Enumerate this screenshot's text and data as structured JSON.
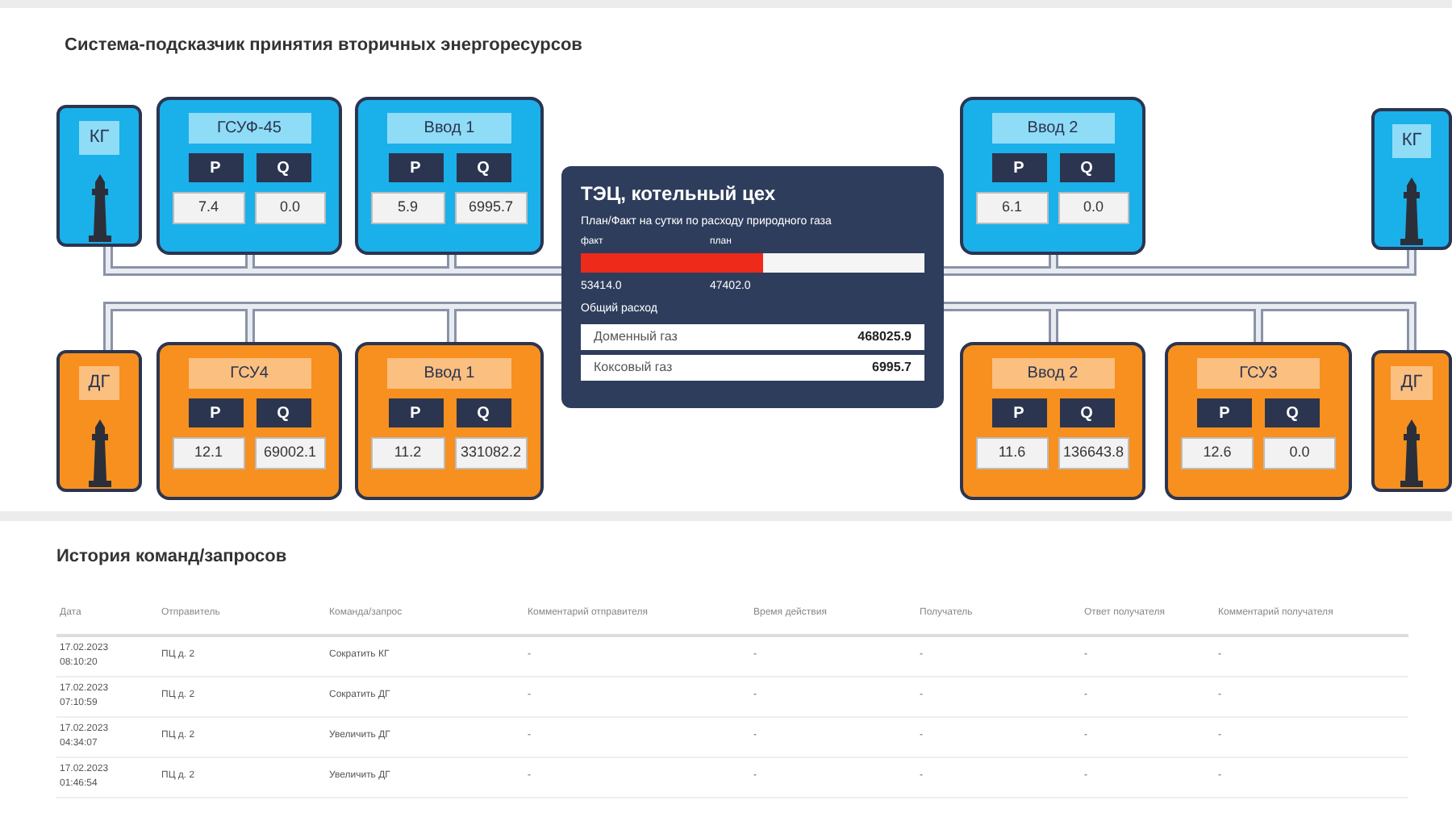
{
  "diagram": {
    "title": "Система-подсказчик принятия вторичных энергоресурсов",
    "nodes": [
      {
        "kind": "tower",
        "label": "КГ",
        "color": "#1ab0ea"
      },
      {
        "kind": "unit",
        "label": "ГСУФ-45",
        "color": "#1ab0ea",
        "p_label": "P",
        "q_label": "Q",
        "p_value": "7.4",
        "q_value": "0.0"
      },
      {
        "kind": "unit",
        "label": "Ввод 1",
        "color": "#1ab0ea",
        "p_label": "P",
        "q_label": "Q",
        "p_value": "5.9",
        "q_value": "6995.7"
      },
      {
        "kind": "unit",
        "label": "Ввод 2",
        "color": "#1ab0ea",
        "p_label": "P",
        "q_label": "Q",
        "p_value": "6.1",
        "q_value": "0.0"
      },
      {
        "kind": "tower",
        "label": "КГ",
        "color": "#1ab0ea"
      },
      {
        "kind": "tower",
        "label": "ДГ",
        "color": "#f7901e"
      },
      {
        "kind": "unit",
        "label": "ГСУ4",
        "color": "#f7901e",
        "p_label": "P",
        "q_label": "Q",
        "p_value": "12.1",
        "q_value": "69002.1"
      },
      {
        "kind": "unit",
        "label": "Ввод 1",
        "color": "#f7901e",
        "p_label": "P",
        "q_label": "Q",
        "p_value": "11.2",
        "q_value": "331082.2"
      },
      {
        "kind": "unit",
        "label": "Ввод 2",
        "color": "#f7901e",
        "p_label": "P",
        "q_label": "Q",
        "p_value": "11.6",
        "q_value": "136643.8"
      },
      {
        "kind": "unit",
        "label": "ГСУ3",
        "color": "#f7901e",
        "p_label": "P",
        "q_label": "Q",
        "p_value": "12.6",
        "q_value": "0.0"
      },
      {
        "kind": "tower",
        "label": "ДГ",
        "color": "#f7901e"
      }
    ],
    "plant": {
      "title": "ТЭЦ, котельный цех",
      "subtitle": "План/Факт на сутки по расходу природного газа",
      "fact_label": "факт",
      "plan_label": "план",
      "level": 0.53,
      "fact_value": "53414.0",
      "plan_value": "47402.0",
      "total_label": "Общий расход",
      "gases": [
        {
          "name": "Доменный газ",
          "value": "468025.9"
        },
        {
          "name": "Коксовый газ",
          "value": "6995.7"
        }
      ]
    }
  },
  "history": {
    "title": "История команд/запросов",
    "columns": [
      "Дата",
      "Отправитель",
      "Команда/запрос",
      "Комментарий отправителя",
      "Время действия",
      "Получатель",
      "Ответ получателя",
      "Комментарий получателя"
    ],
    "rows": [
      [
        "17.02.2023 08:10:20",
        "ПЦ д. 2",
        "Сократить КГ",
        "-",
        "-",
        "-",
        "-",
        "-"
      ],
      [
        "17.02.2023 07:10:59",
        "ПЦ д. 2",
        "Сократить ДГ",
        "-",
        "-",
        "-",
        "-",
        "-"
      ],
      [
        "17.02.2023 04:34:07",
        "ПЦ д. 2",
        "Увеличить ДГ",
        "-",
        "-",
        "-",
        "-",
        "-"
      ],
      [
        "17.02.2023 01:46:54",
        "ПЦ д. 2",
        "Увеличить ДГ",
        "-",
        "-",
        "-",
        "-",
        "-"
      ]
    ]
  }
}
